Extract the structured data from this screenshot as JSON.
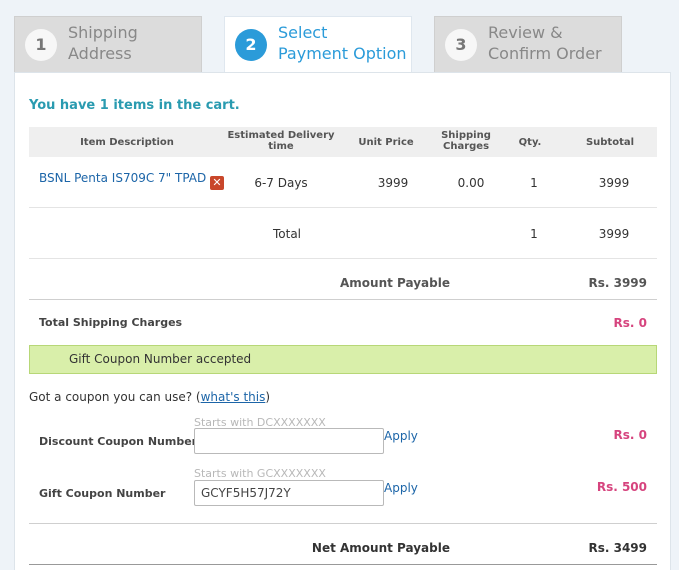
{
  "steps": [
    {
      "num": "1",
      "line1": "Shipping",
      "line2": "Address"
    },
    {
      "num": "2",
      "line1": "Select",
      "line2": "Payment Option"
    },
    {
      "num": "3",
      "line1": "Review &",
      "line2": "Confirm Order"
    }
  ],
  "cart_message": "You have 1 items in the cart.",
  "table": {
    "headers": {
      "item": "Item Description",
      "delivery1": "Estimated Delivery",
      "delivery2": "time",
      "unit_price": "Unit Price",
      "shipping1": "Shipping",
      "shipping2": "Charges",
      "qty": "Qty.",
      "subtotal": "Subtotal"
    },
    "rows": [
      {
        "item": "BSNL Penta IS709C 7\" TPAD",
        "remove_icon": "remove-x-icon",
        "delivery": "6-7 Days",
        "unit_price": "3999",
        "shipping": "0.00",
        "qty": "1",
        "subtotal": "3999"
      }
    ],
    "total": {
      "label": "Total",
      "qty": "1",
      "subtotal": "3999"
    }
  },
  "amount_payable": {
    "label": "Amount Payable",
    "value": "Rs. 3999"
  },
  "shipping_charges": {
    "label": "Total Shipping Charges",
    "value": "Rs. 0"
  },
  "gift_accepted": "Gift Coupon Number accepted",
  "coupon": {
    "question": "Got a coupon you can use? (",
    "link": "what's this",
    "close": ")",
    "discount": {
      "label": "Discount Coupon Number",
      "hint": "Starts with DCXXXXXXX",
      "value": "",
      "apply": "Apply",
      "amount": "Rs. 0"
    },
    "gift": {
      "label": "Gift Coupon Number",
      "hint": "Starts with GCXXXXXXX",
      "value": "GCYF5H57J72Y",
      "apply": "Apply",
      "amount": "Rs. 500"
    }
  },
  "net_amount": {
    "label": "Net Amount Payable",
    "value": "Rs. 3499"
  },
  "colors": {
    "accent": "#2b9bd9",
    "pink": "#d6447e",
    "green_bar": "#d9efaa",
    "link": "#1c65a8"
  }
}
